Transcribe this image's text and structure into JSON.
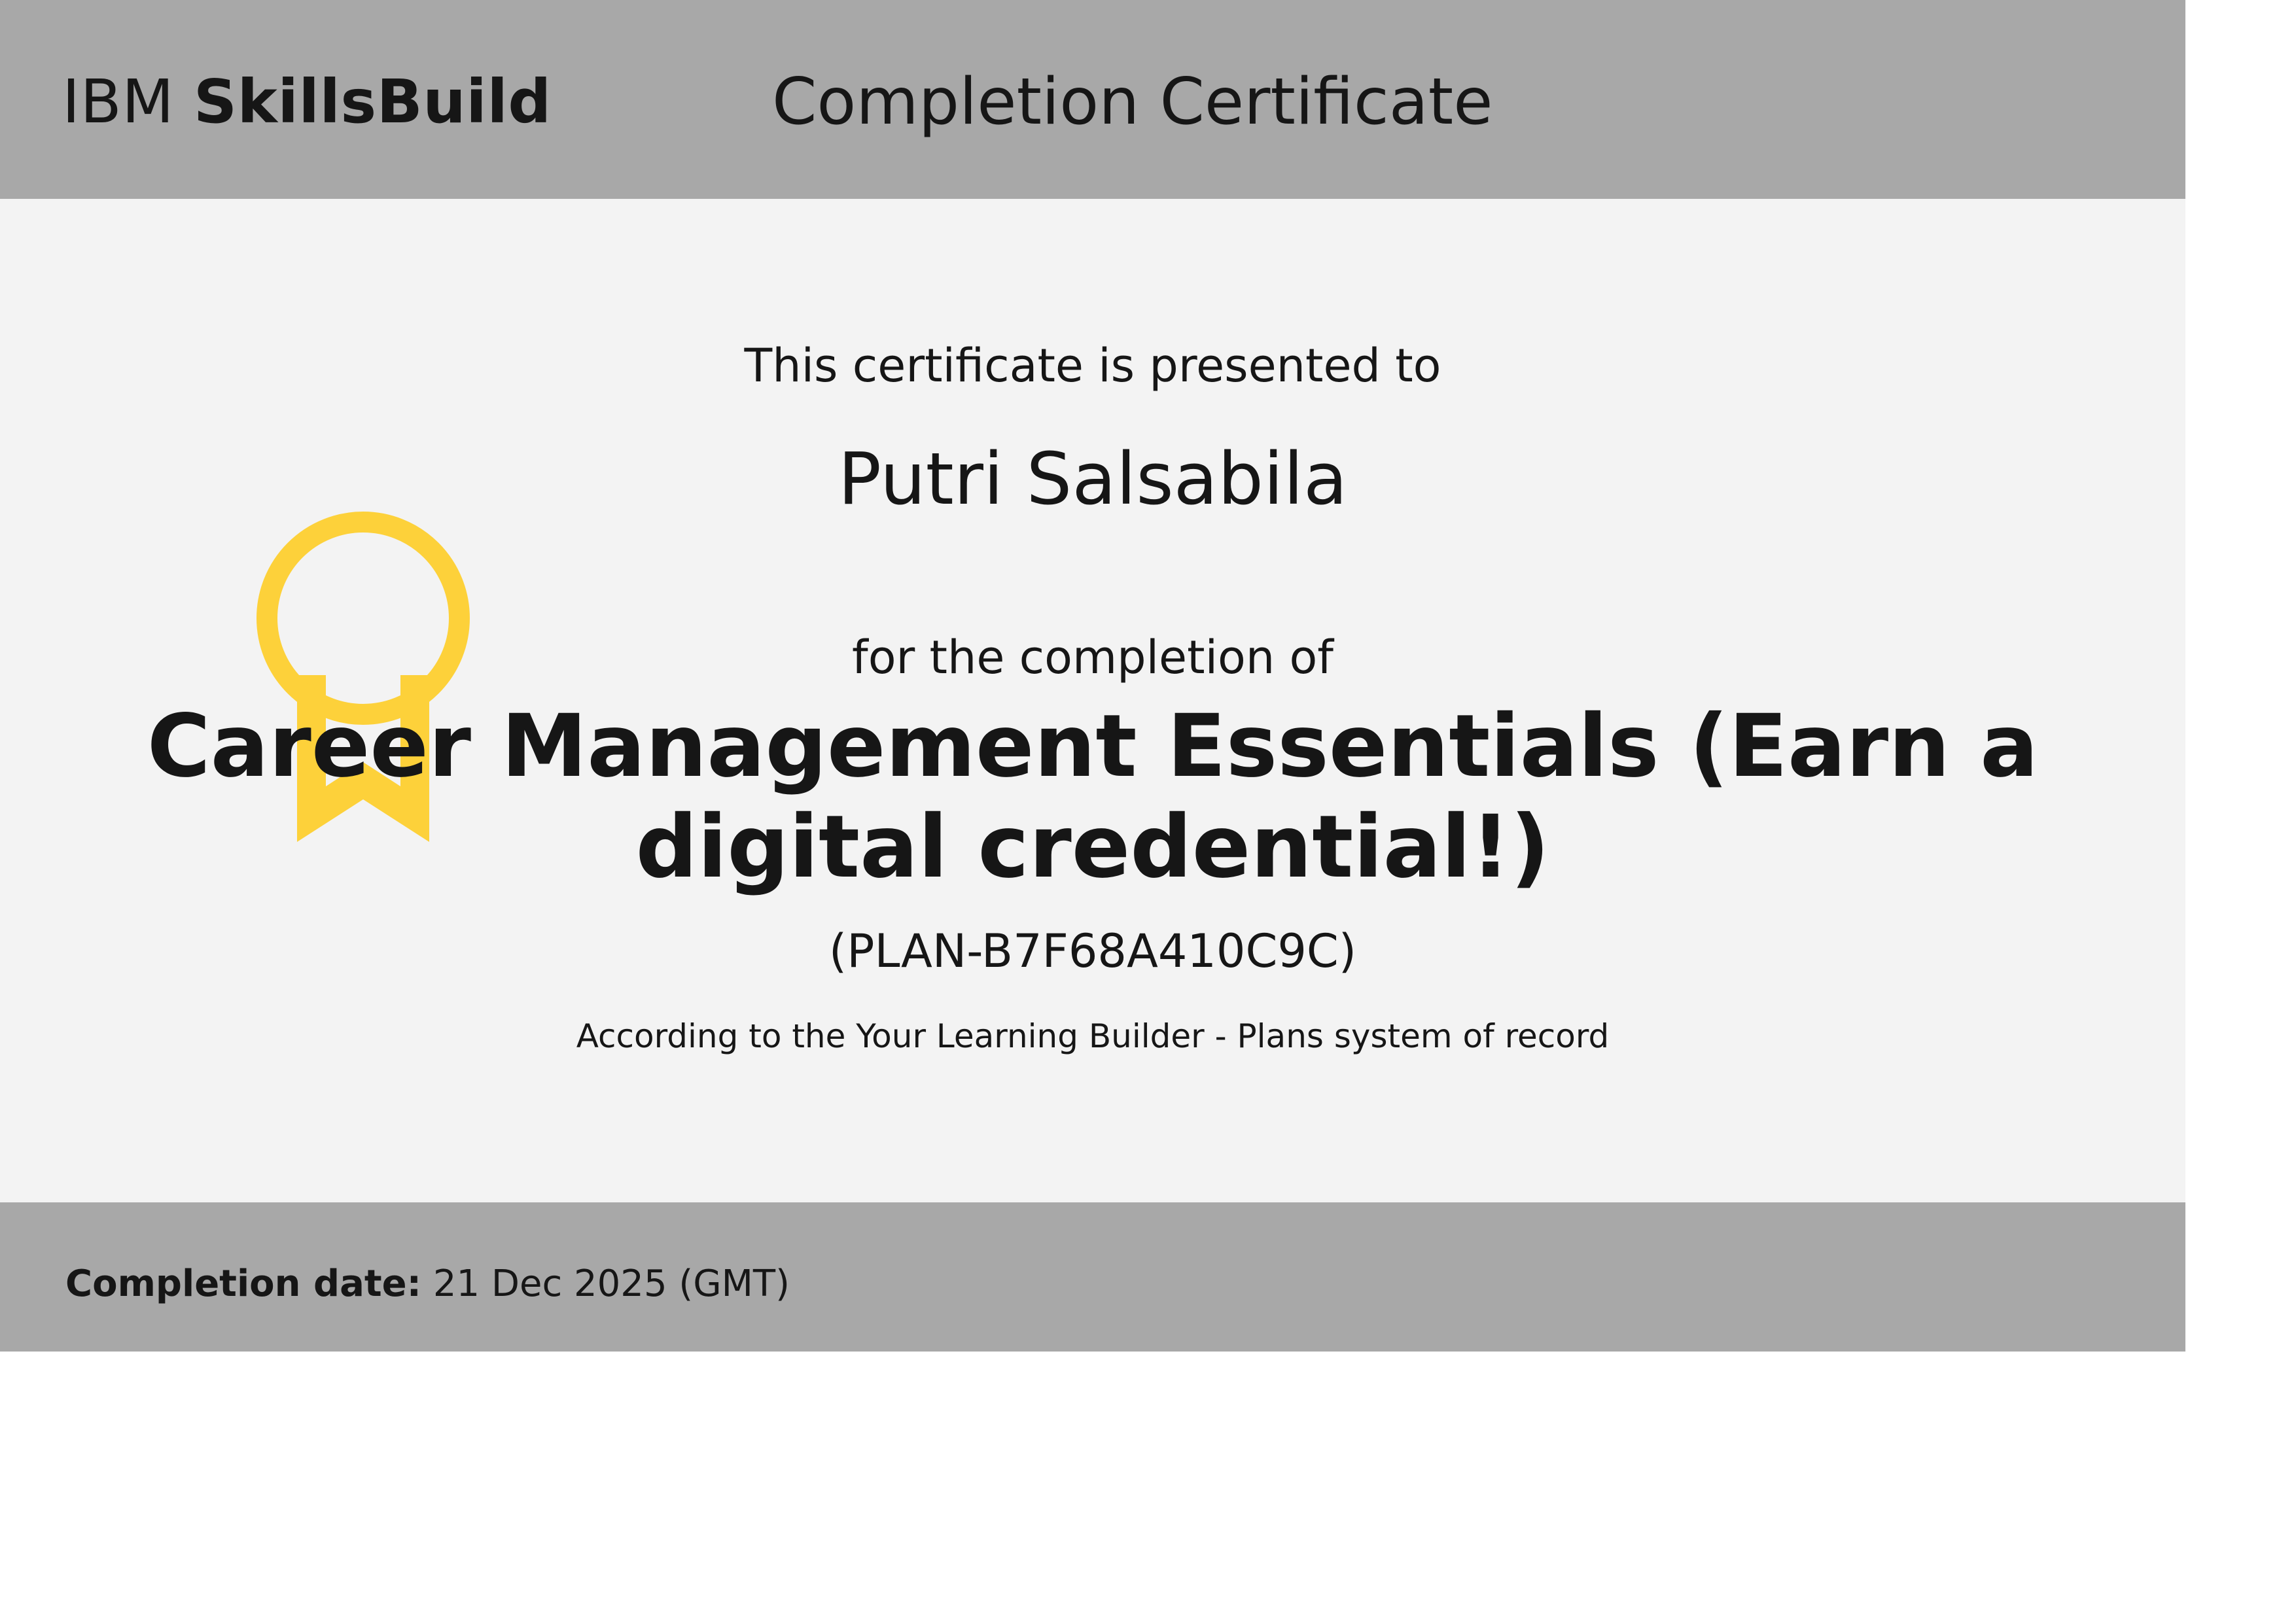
{
  "header": {
    "brand_prefix": "IBM",
    "brand_name": "SkillsBuild",
    "title": "Completion Certificate"
  },
  "body": {
    "presented_text": "This certificate is presented to",
    "recipient_name": "Putri Salsabila",
    "completion_text": "for the completion of",
    "course_name": "Career Management Essentials (Earn a digital credential!)",
    "plan_id": "(PLAN-B7F68A410C9C)",
    "record_text": "According to the Your Learning Builder - Plans system of record",
    "award_icon": "award-ribbon-icon"
  },
  "footer": {
    "completion_label": "Completion date:",
    "completion_value": "21 Dec 2025 (GMT)"
  },
  "colors": {
    "header_footer": "#a8a8a8",
    "body_background": "#f3f3f3",
    "award": "#fdd13a",
    "text": "#161616"
  }
}
